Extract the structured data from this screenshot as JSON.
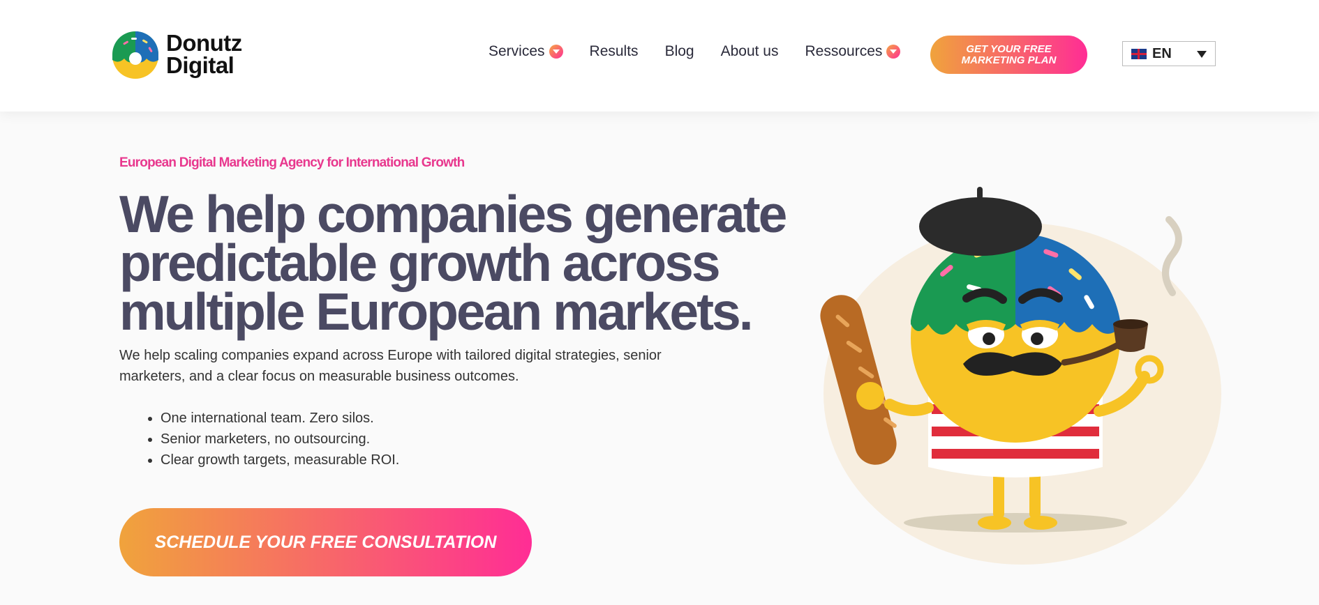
{
  "brand": {
    "name_line1": "Donutz",
    "name_line2": "Digital"
  },
  "nav": {
    "items": [
      {
        "label": "Services",
        "has_dropdown": true
      },
      {
        "label": "Results",
        "has_dropdown": false
      },
      {
        "label": "Blog",
        "has_dropdown": false
      },
      {
        "label": "About us",
        "has_dropdown": false
      },
      {
        "label": "Ressources",
        "has_dropdown": true
      }
    ],
    "cta_line1": "GET YOUR FREE",
    "cta_line2": "MARKETING PLAN",
    "language": "EN"
  },
  "hero": {
    "eyebrow": "European Digital Marketing Agency for International Growth",
    "headline": "We help companies generate predictable growth across multiple European markets.",
    "subtext": "We help scaling companies expand across Europe with tailored digital strategies, senior marketers, and a clear focus on measurable business outcomes.",
    "bullets": [
      "One international team. Zero silos.",
      "Senior marketers, no outsourcing.",
      "Clear growth targets, measurable ROI."
    ],
    "cta_label": "SCHEDULE YOUR FREE CONSULTATION"
  },
  "colors": {
    "accent_pink": "#ff2d95",
    "accent_orange": "#f0a33c",
    "headline": "#4b4a63",
    "eyebrow": "#e8388e"
  }
}
